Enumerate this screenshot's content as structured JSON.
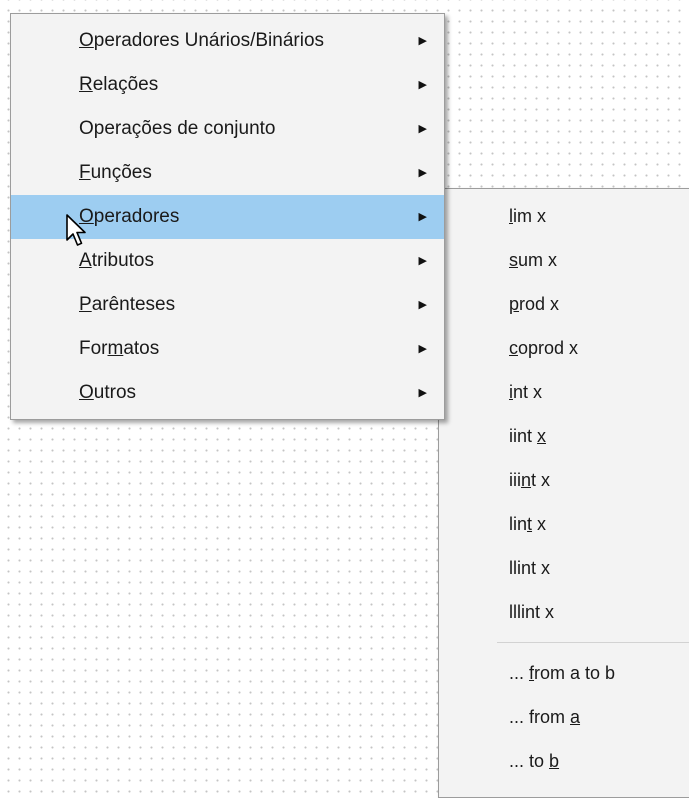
{
  "main_menu": {
    "items": [
      {
        "pre": "",
        "ul": "O",
        "post": "peradores Unários/Binários",
        "has_submenu": true
      },
      {
        "pre": "",
        "ul": "R",
        "post": "elações",
        "has_submenu": true
      },
      {
        "pre": "Operações de con",
        "ul": "j",
        "post": "unto",
        "has_submenu": true
      },
      {
        "pre": "",
        "ul": "F",
        "post": "unções",
        "has_submenu": true
      },
      {
        "pre": "",
        "ul": "O",
        "post": "peradores",
        "has_submenu": true,
        "highlighted": true
      },
      {
        "pre": "",
        "ul": "A",
        "post": "tributos",
        "has_submenu": true
      },
      {
        "pre": "",
        "ul": "P",
        "post": "arênteses",
        "has_submenu": true
      },
      {
        "pre": "For",
        "ul": "m",
        "post": "atos",
        "has_submenu": true
      },
      {
        "pre": "",
        "ul": "O",
        "post": "utros",
        "has_submenu": true
      }
    ],
    "arrow_glyph": "▶",
    "highlight_color": "#9dcdf1"
  },
  "operators_submenu": {
    "items": [
      {
        "pre": "",
        "ul": "l",
        "post": "im x"
      },
      {
        "pre": "",
        "ul": "s",
        "post": "um x"
      },
      {
        "pre": "",
        "ul": "p",
        "post": "rod x"
      },
      {
        "pre": "",
        "ul": "c",
        "post": "oprod x"
      },
      {
        "pre": "",
        "ul": "i",
        "post": "nt x"
      },
      {
        "pre": "iint ",
        "ul": "x",
        "post": ""
      },
      {
        "pre": "iii",
        "ul": "n",
        "post": "t x"
      },
      {
        "pre": "lin",
        "ul": "t",
        "post": " x"
      },
      {
        "pre": "llint x",
        "ul": "",
        "post": ""
      },
      {
        "pre": "lllint x",
        "ul": "",
        "post": ""
      },
      {
        "separator": true
      },
      {
        "pre": "... ",
        "ul": "f",
        "post": "rom a to b"
      },
      {
        "pre": "... from ",
        "ul": "a",
        "post": ""
      },
      {
        "pre": "... to ",
        "ul": "b",
        "post": ""
      }
    ]
  },
  "cursor": {
    "icon": "arrow-pointer-icon"
  }
}
